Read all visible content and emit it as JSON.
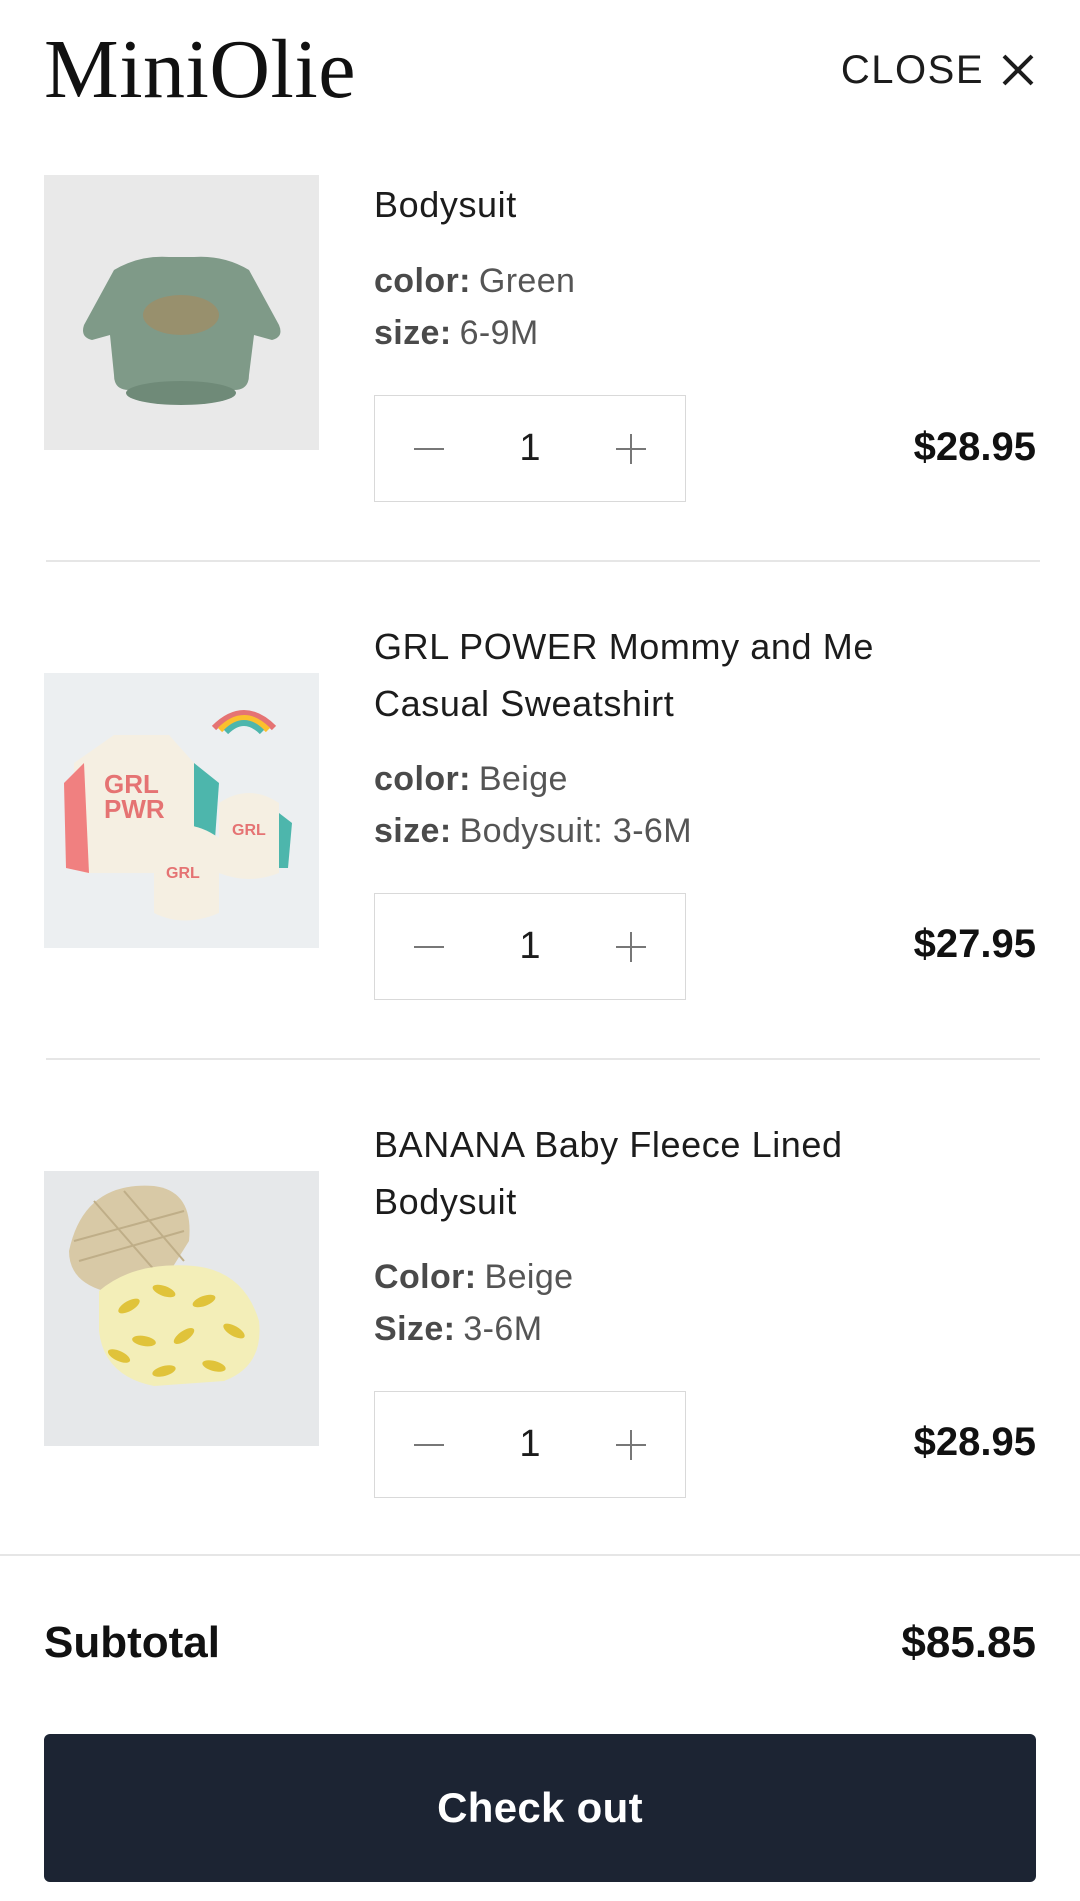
{
  "header": {
    "brand": "MiniOlie",
    "close_label": "CLOSE"
  },
  "cart": {
    "items": [
      {
        "title": "Bodysuit",
        "options": [
          {
            "key": "color:",
            "value": "Green"
          },
          {
            "key": "size:",
            "value": "6-9M"
          }
        ],
        "quantity": "1",
        "price": "$28.95",
        "image_icon": "green-bodysuit-image"
      },
      {
        "title_line1": "GRL POWER Mommy and Me",
        "title_line2": "Casual Sweatshirt",
        "options": [
          {
            "key": "color:",
            "value": "Beige"
          },
          {
            "key": "size:",
            "value": "Bodysuit: 3-6M"
          }
        ],
        "quantity": "1",
        "price": "$27.95",
        "image_icon": "grl-power-sweatshirt-image"
      },
      {
        "title_line1": "BANANA Baby Fleece Lined",
        "title_line2": "Bodysuit",
        "options": [
          {
            "key": "Color:",
            "value": "Beige"
          },
          {
            "key": "Size:",
            "value": "3-6M"
          }
        ],
        "quantity": "1",
        "price": "$28.95",
        "image_icon": "banana-bodysuit-image"
      }
    ]
  },
  "footer": {
    "subtotal_label": "Subtotal",
    "subtotal_value": "$85.85",
    "checkout_label": "Check out"
  },
  "colors": {
    "checkout_bg": "#1c2433",
    "divider": "#e6e6e6"
  }
}
